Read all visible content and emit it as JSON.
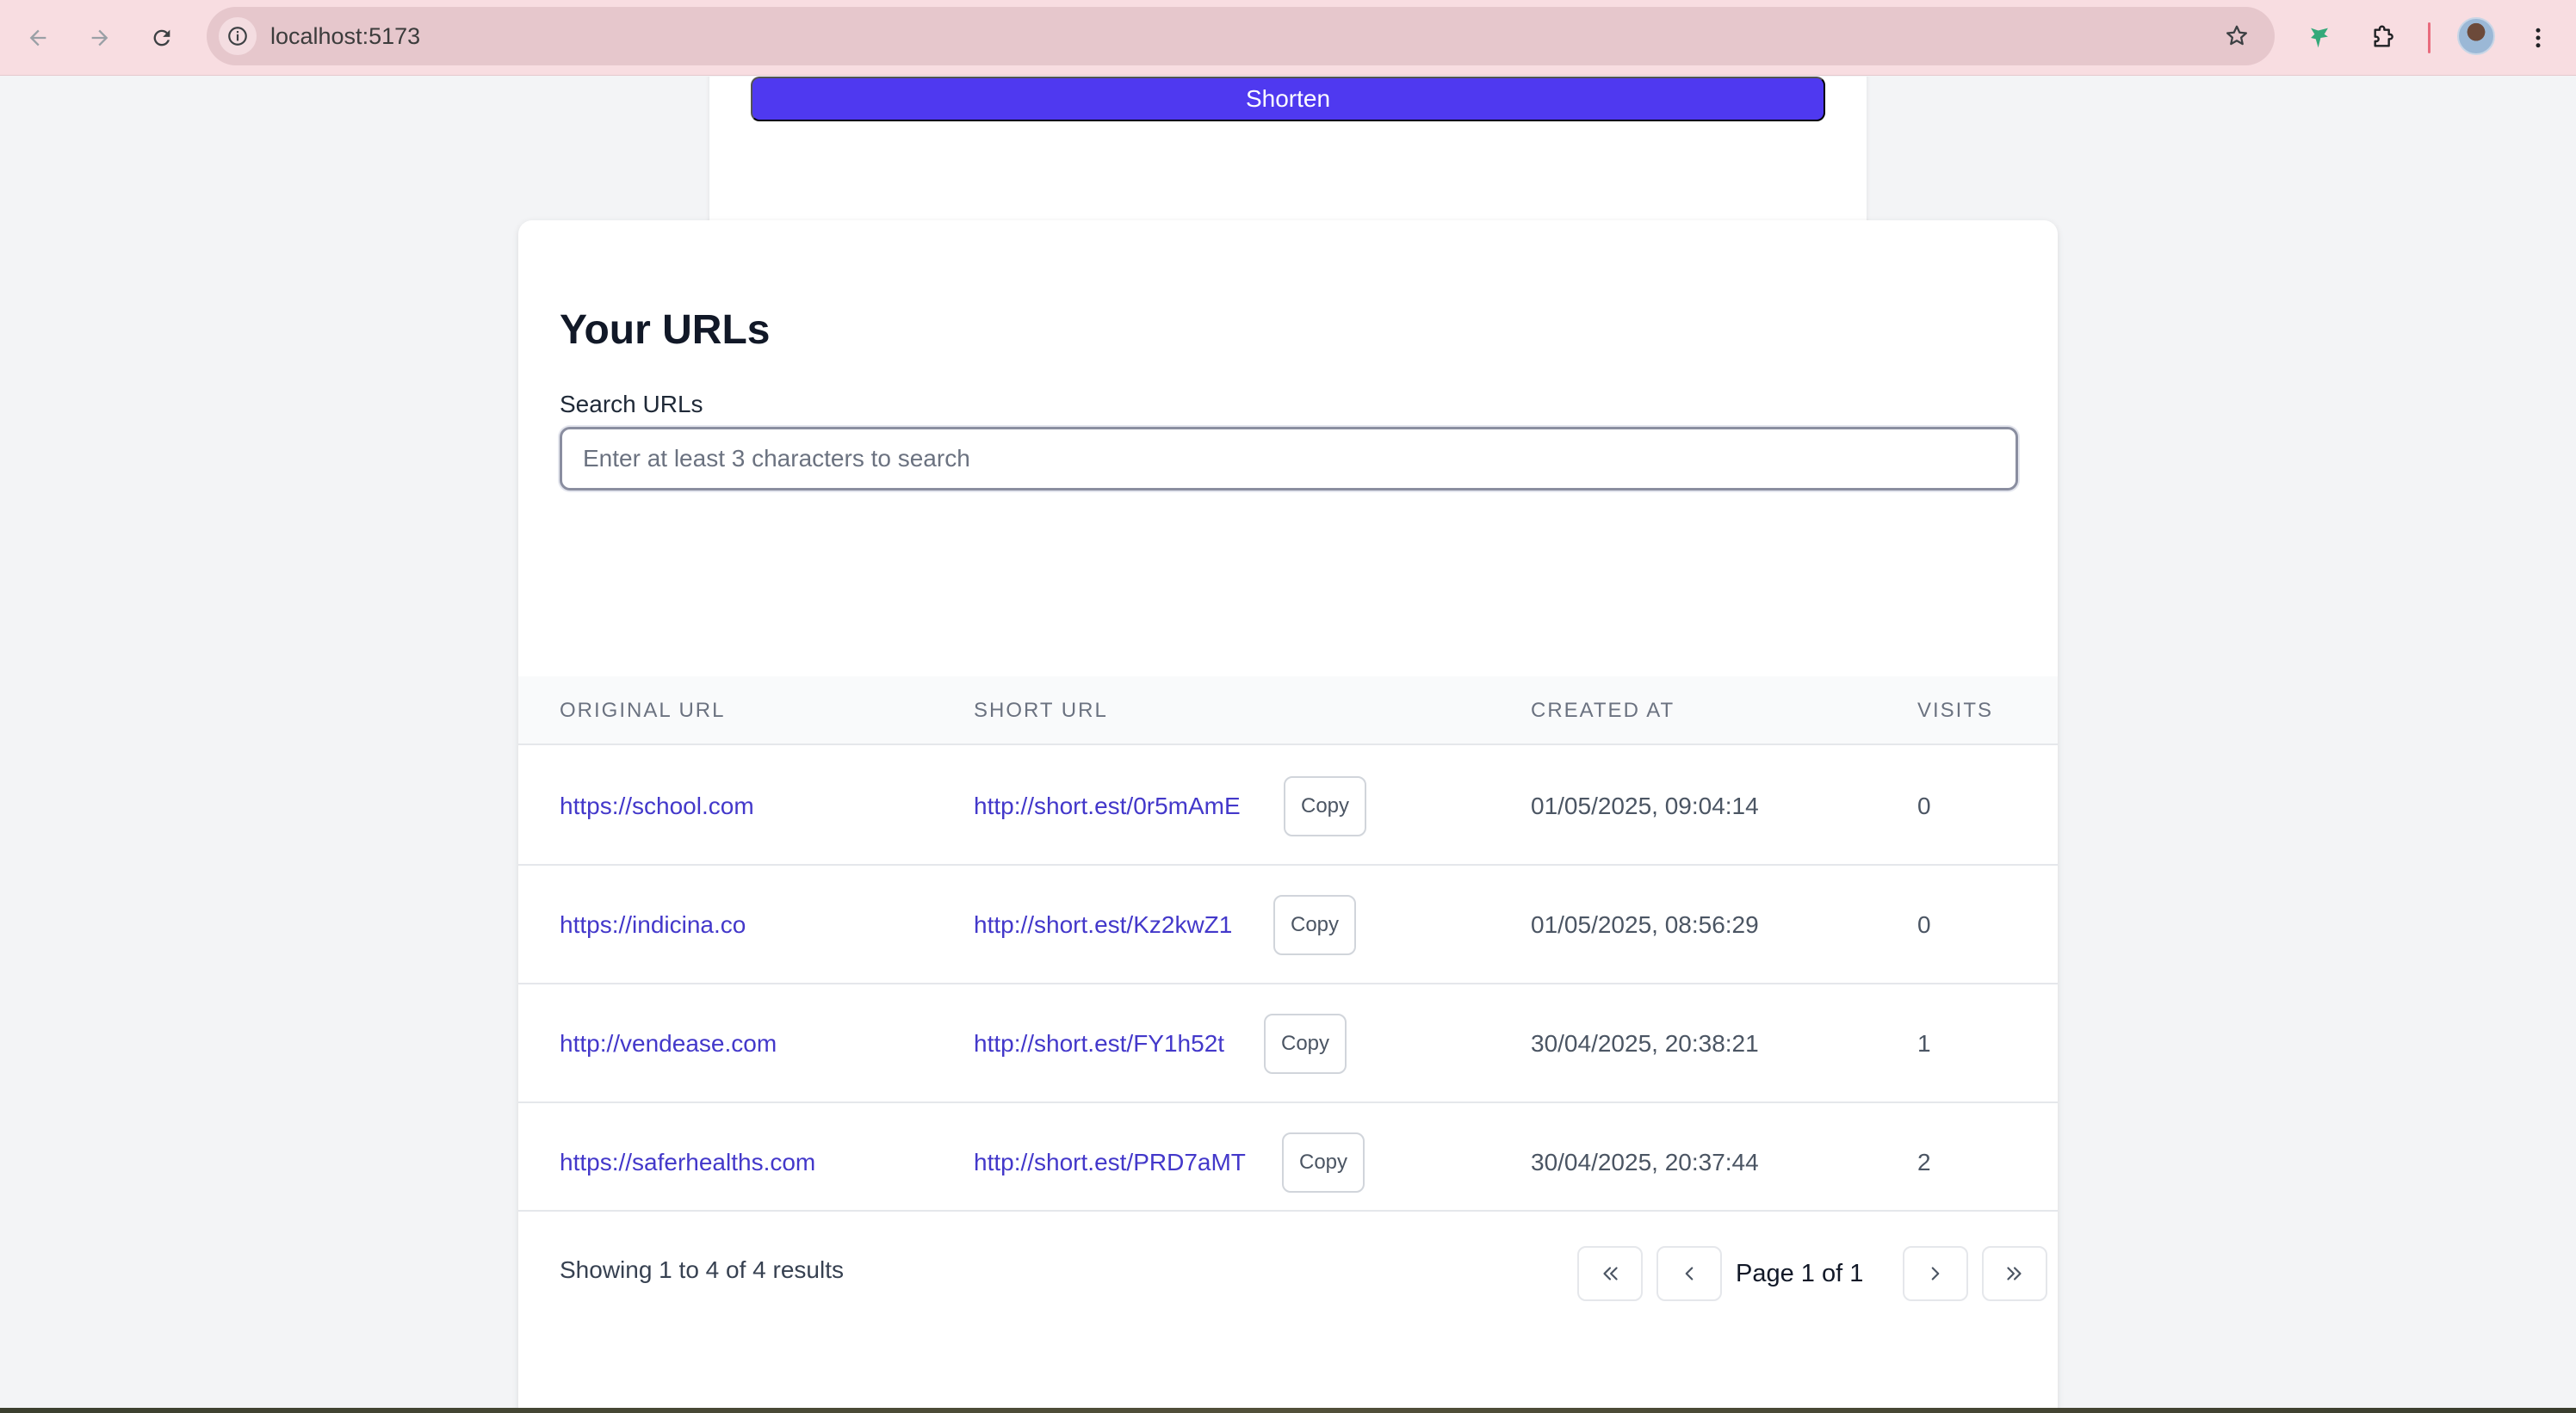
{
  "browser": {
    "url": "localhost:5173",
    "icons": [
      "back-arrow-icon",
      "forward-arrow-icon",
      "reload-icon",
      "site-info-icon",
      "bookmark-star-icon",
      "extension-app-icon",
      "extensions-puzzle-icon",
      "profile-avatar",
      "more-vert-icon"
    ]
  },
  "form": {
    "shorten_label": "Shorten"
  },
  "urls": {
    "title": "Your URLs",
    "search_label": "Search URLs",
    "search_placeholder": "Enter at least 3 characters to search",
    "search_value": "",
    "columns": [
      "ORIGINAL URL",
      "SHORT URL",
      "CREATED AT",
      "VISITS"
    ],
    "rows": [
      {
        "original": "https://school.com",
        "short": "http://short.est/0r5mAmE",
        "created": "01/05/2025, 09:04:14",
        "visits": "0"
      },
      {
        "original": "https://indicina.co",
        "short": "http://short.est/Kz2kwZ1",
        "created": "01/05/2025, 08:56:29",
        "visits": "0"
      },
      {
        "original": "http://vendease.com",
        "short": "http://short.est/FY1h52t",
        "created": "30/04/2025, 20:38:21",
        "visits": "1"
      },
      {
        "original": "https://saferhealths.com",
        "short": "http://short.est/PRD7aMT",
        "created": "30/04/2025, 20:37:44",
        "visits": "2"
      }
    ],
    "copy_label": "Copy",
    "showing": "Showing 1 to 4 of 4 results",
    "page_label": "Page 1 of 1"
  },
  "colors": {
    "accent": "#4f39f0",
    "link": "#4338ca",
    "chrome_bg": "#f8dde1"
  }
}
